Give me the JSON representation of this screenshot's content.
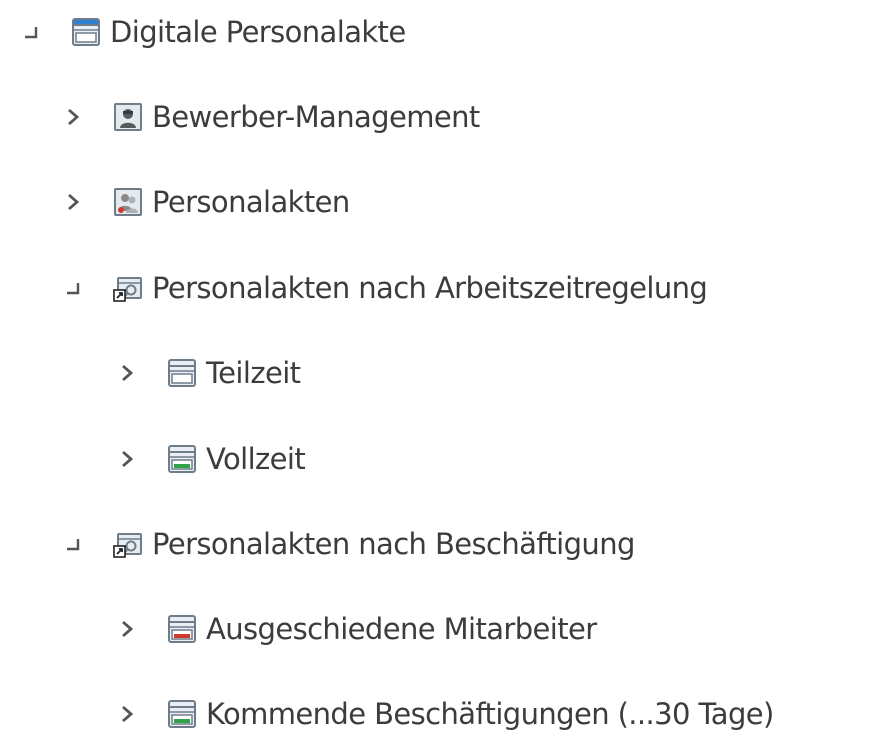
{
  "tree": {
    "nodes": [
      {
        "id": "digitale-personalakte",
        "label": "Digitale Personalakte",
        "expanded": true,
        "toggle_icon": "collapse-icon",
        "icon": "folder-blue-icon",
        "colors": {
          "band": "#2f7fd0"
        }
      },
      {
        "id": "bewerber-management",
        "label": "Bewerber-Management",
        "expanded": false,
        "toggle_icon": "chevron-right-icon",
        "icon": "applicant-icon"
      },
      {
        "id": "personalakten",
        "label": "Personalakten",
        "expanded": false,
        "toggle_icon": "chevron-right-icon",
        "icon": "personnel-files-icon"
      },
      {
        "id": "personalakten-nach-arbeitszeitregelung",
        "label": "Personalakten nach Arbeitszeitregelung",
        "expanded": true,
        "toggle_icon": "collapse-icon",
        "icon": "search-link-icon"
      },
      {
        "id": "teilzeit",
        "label": "Teilzeit",
        "expanded": false,
        "toggle_icon": "chevron-right-icon",
        "icon": "folder-white-icon",
        "colors": {
          "band": "#ffffff"
        }
      },
      {
        "id": "vollzeit",
        "label": "Vollzeit",
        "expanded": false,
        "toggle_icon": "chevron-right-icon",
        "icon": "folder-green-icon",
        "colors": {
          "band": "#2fa34a"
        }
      },
      {
        "id": "personalakten-nach-beschaeftigung",
        "label": "Personalakten nach Beschäftigung",
        "expanded": true,
        "toggle_icon": "collapse-icon",
        "icon": "search-link-icon"
      },
      {
        "id": "ausgeschiedene-mitarbeiter",
        "label": "Ausgeschiedene Mitarbeiter",
        "expanded": false,
        "toggle_icon": "chevron-right-icon",
        "icon": "folder-red-icon",
        "colors": {
          "band": "#d33a2f"
        }
      },
      {
        "id": "kommende-beschaeftigungen",
        "label": "Kommende Beschäftigungen (...30 Tage)",
        "expanded": false,
        "toggle_icon": "chevron-right-icon",
        "icon": "folder-green-icon",
        "colors": {
          "band": "#2fa34a"
        }
      }
    ]
  },
  "colors": {
    "text": "#3c3c3c",
    "toggle": "#555555",
    "icon_frame": "#7e8b96",
    "icon_fill": "#dce6ee"
  }
}
